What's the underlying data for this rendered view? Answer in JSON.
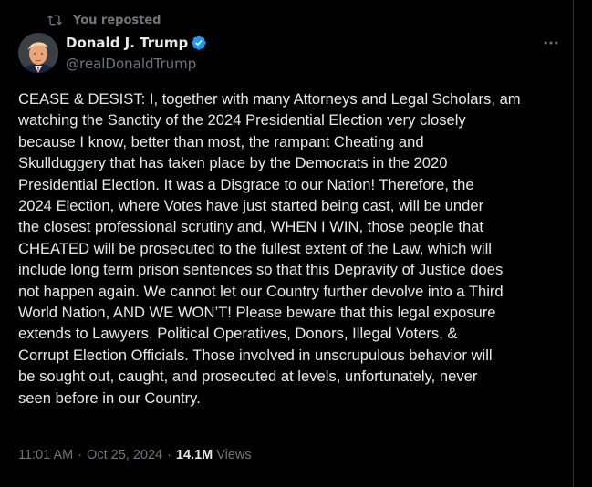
{
  "repost": {
    "label": "You reposted"
  },
  "author": {
    "name": "Donald J. Trump",
    "handle": "@realDonaldTrump",
    "verified": true,
    "badge_color": "#1d9bf0"
  },
  "post": {
    "text": "CEASE & DESIST: I, together with many Attorneys and Legal Scholars, am\nwatching the Sanctity of the 2024 Presidential Election very closely\nbecause I know, better than most, the rampant Cheating and\nSkullduggery that has taken place by the Democrats in the 2020\nPresidential Election. It was a Disgrace to our Nation! Therefore, the\n2024 Election, where Votes have just started being cast, will be under\nthe closest professional scrutiny and, WHEN I WIN, those people that\nCHEATED will be prosecuted to the fullest extent of the Law, which will\ninclude long term prison sentences so that this Depravity of Justice does\nnot happen again. We cannot let our Country further devolve into a Third\nWorld Nation, AND WE WON’T! Please beware that this legal exposure\nextends to Lawyers, Political Operatives, Donors, Illegal Voters, &\nCorrupt Election Officials. Those involved in unscrupulous behavior will\nbe sought out, caught, and prosecuted at levels, unfortunately, never\nseen before in our Country."
  },
  "meta": {
    "time": "11:01 AM",
    "separator": "·",
    "date": "Oct 25, 2024",
    "views_count": "14.1M",
    "views_label": "Views"
  },
  "icons": {
    "repost": "repost-icon",
    "more": "more-icon",
    "verified": "verified-badge-icon"
  },
  "colors": {
    "background": "#000000",
    "text": "#e7e9ea",
    "secondary": "#71767b",
    "accent": "#1d9bf0"
  }
}
